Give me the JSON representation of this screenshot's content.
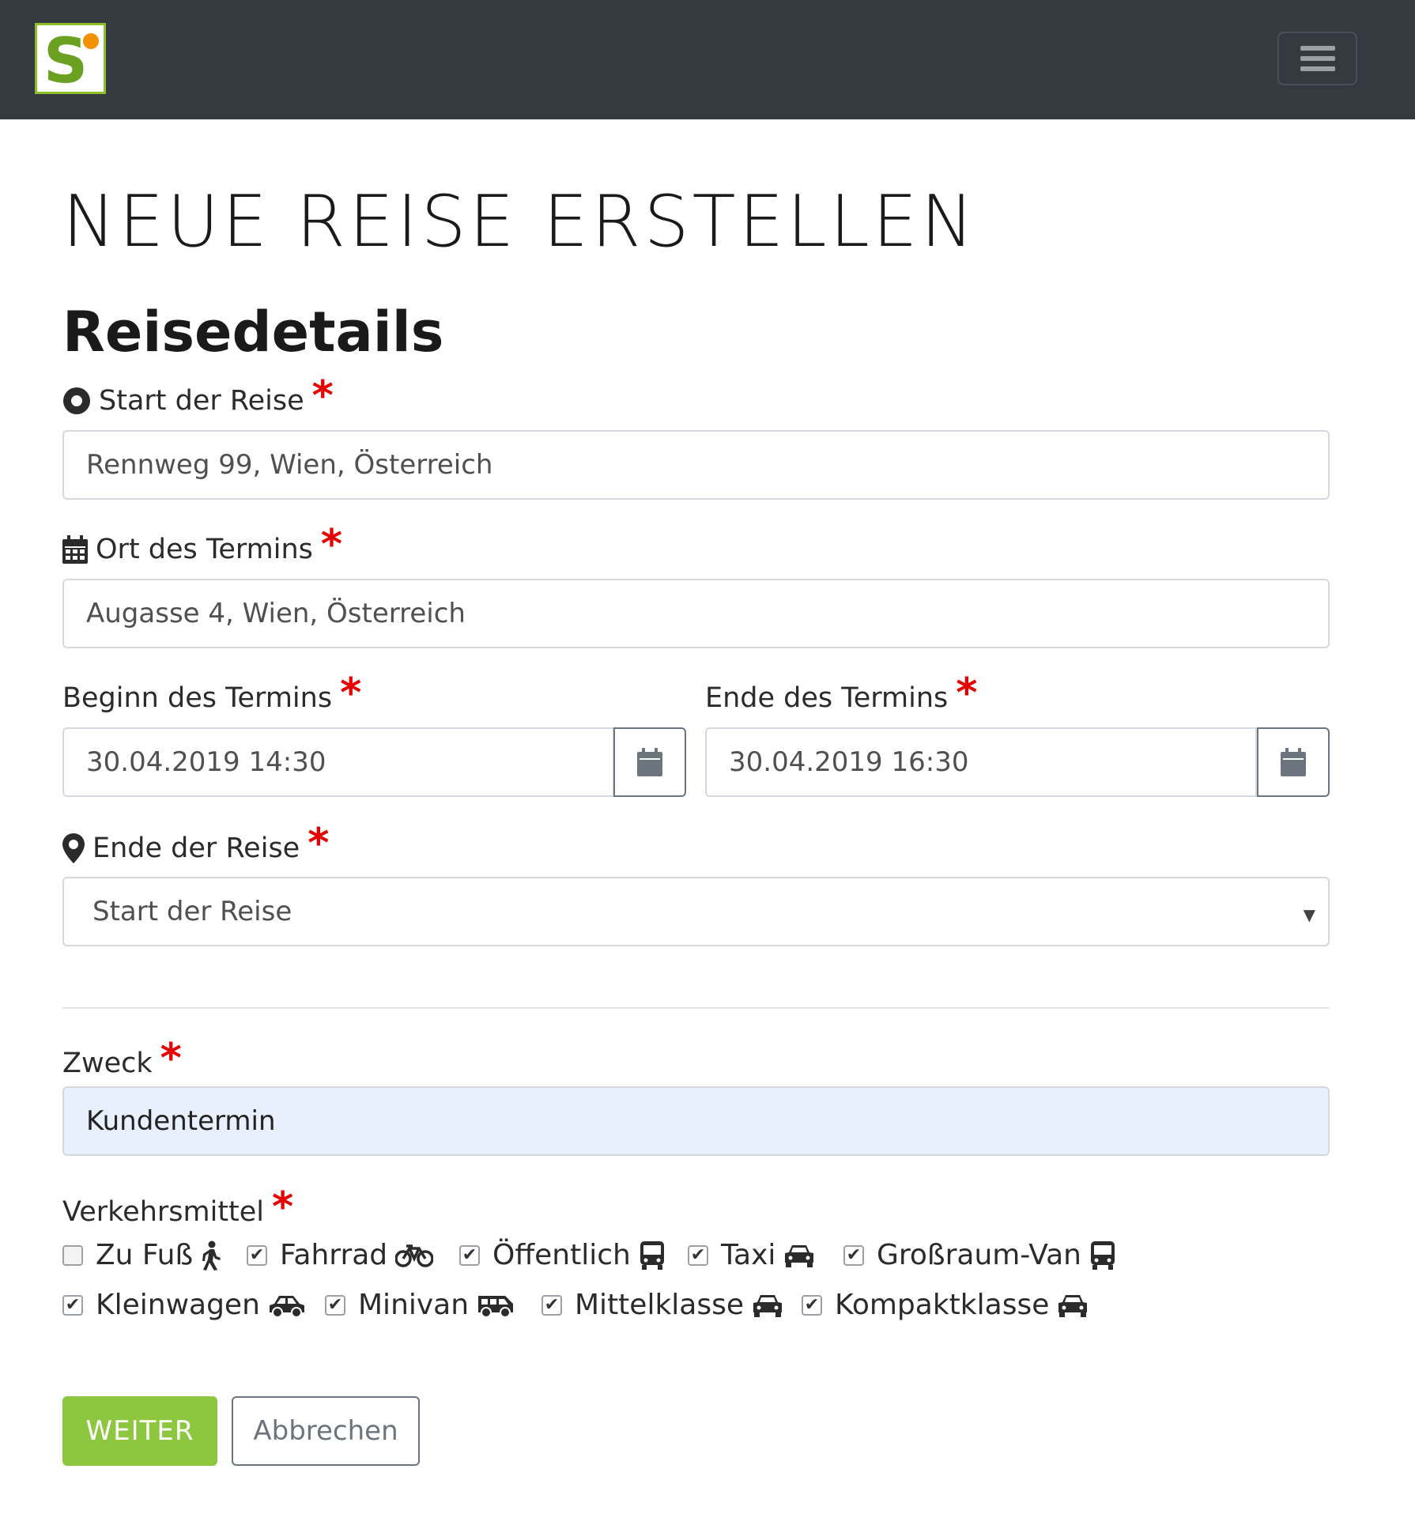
{
  "brand": {
    "logo_icon": "splendid-s-logo-icon",
    "accent": "#8dc63f",
    "dot": "#f39200"
  },
  "navbar": {
    "toggle_icon": "hamburger-menu-icon"
  },
  "page": {
    "title": "NEUE REISE ERSTELLEN",
    "section": "Reisedetails"
  },
  "form": {
    "start": {
      "label": "Start der Reise",
      "icon": "circle-dot-icon",
      "value": "Rennweg 99, Wien, Österreich"
    },
    "termin_ort": {
      "label": "Ort des Termins",
      "icon": "calendar-icon",
      "value": "Augasse 4, Wien, Österreich"
    },
    "beginn": {
      "label": "Beginn des Termins",
      "value": "30.04.2019 14:30",
      "button_icon": "calendar-icon"
    },
    "ende_termin": {
      "label": "Ende des Termins",
      "value": "30.04.2019 16:30",
      "button_icon": "calendar-icon"
    },
    "ende_reise": {
      "label": "Ende der Reise",
      "icon": "map-marker-icon",
      "selected": "Start der Reise"
    },
    "zweck": {
      "label": "Zweck",
      "value": "Kundentermin"
    },
    "verkehrsmittel": {
      "label": "Verkehrsmittel",
      "options": [
        {
          "label": "Zu Fuß",
          "checked": false,
          "icon": "walking-icon"
        },
        {
          "label": "Fahrrad",
          "checked": true,
          "icon": "bicycle-icon"
        },
        {
          "label": "Öffentlich",
          "checked": true,
          "icon": "bus-icon"
        },
        {
          "label": "Taxi",
          "checked": true,
          "icon": "car-front-icon"
        },
        {
          "label": "Großraum-Van",
          "checked": true,
          "icon": "bus-icon"
        },
        {
          "label": "Kleinwagen",
          "checked": true,
          "icon": "car-side-icon"
        },
        {
          "label": "Minivan",
          "checked": true,
          "icon": "van-icon"
        },
        {
          "label": "Mittelklasse",
          "checked": true,
          "icon": "car-front-icon"
        },
        {
          "label": "Kompaktklasse",
          "checked": true,
          "icon": "car-front-icon"
        }
      ]
    },
    "required_mark": "*"
  },
  "actions": {
    "submit": "WEITER",
    "cancel": "Abbrechen"
  }
}
